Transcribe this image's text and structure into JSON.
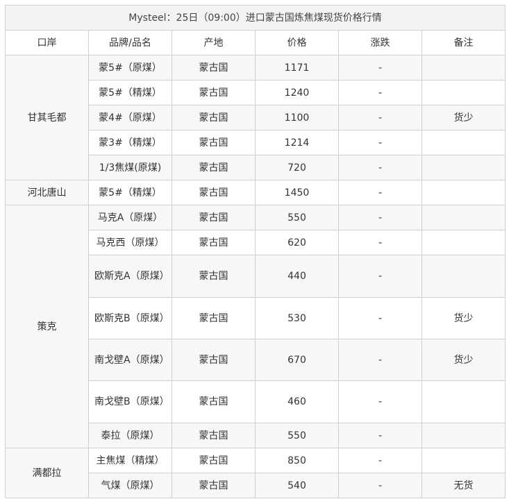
{
  "table": {
    "title": "Mysteel：25日（09:00）进口蒙古国炼焦煤现货价格行情",
    "headers": [
      "口岸",
      "品牌/品名",
      "产地",
      "价格",
      "涨跌",
      "备注"
    ],
    "rows": [
      {
        "port": "甘其毛都",
        "brand": "蒙5#（原煤）",
        "origin": "蒙古国",
        "price": "1171",
        "change": "-",
        "note": ""
      },
      {
        "port": "",
        "brand": "蒙5#（精煤）",
        "origin": "蒙古国",
        "price": "1240",
        "change": "-",
        "note": ""
      },
      {
        "port": "",
        "brand": "蒙4#（原煤）",
        "origin": "蒙古国",
        "price": "1100",
        "change": "-",
        "note": "货少"
      },
      {
        "port": "",
        "brand": "蒙3#（精煤）",
        "origin": "蒙古国",
        "price": "1214",
        "change": "-",
        "note": ""
      },
      {
        "port": "",
        "brand": "1/3焦煤(原煤)",
        "origin": "蒙古国",
        "price": "720",
        "change": "-",
        "note": ""
      },
      {
        "port": "河北唐山",
        "brand": "蒙5#（精煤）",
        "origin": "蒙古国",
        "price": "1450",
        "change": "-",
        "note": ""
      },
      {
        "port": "策克",
        "brand": "马克A（原煤）",
        "origin": "蒙古国",
        "price": "550",
        "change": "-",
        "note": ""
      },
      {
        "port": "",
        "brand": "马克西（原煤）",
        "origin": "蒙古国",
        "price": "620",
        "change": "-",
        "note": ""
      },
      {
        "port": "",
        "brand": "欧斯克A（原煤）",
        "origin": "蒙古国",
        "price": "440",
        "change": "-",
        "note": ""
      },
      {
        "port": "",
        "brand": "欧斯克B（原煤）",
        "origin": "蒙古国",
        "price": "530",
        "change": "-",
        "note": "货少"
      },
      {
        "port": "",
        "brand": "南戈壁A（原煤）",
        "origin": "蒙古国",
        "price": "670",
        "change": "-",
        "note": "货少"
      },
      {
        "port": "",
        "brand": "南戈壁B（原煤）",
        "origin": "蒙古国",
        "price": "460",
        "change": "-",
        "note": ""
      },
      {
        "port": "",
        "brand": "泰拉（原煤）",
        "origin": "蒙古国",
        "price": "550",
        "change": "-",
        "note": ""
      },
      {
        "port": "满都拉",
        "brand": "主焦煤（精煤）",
        "origin": "蒙古国",
        "price": "850",
        "change": "-",
        "note": ""
      },
      {
        "port": "",
        "brand": "气煤（原煤）",
        "origin": "蒙古国",
        "price": "540",
        "change": "-",
        "note": "无货"
      }
    ]
  }
}
